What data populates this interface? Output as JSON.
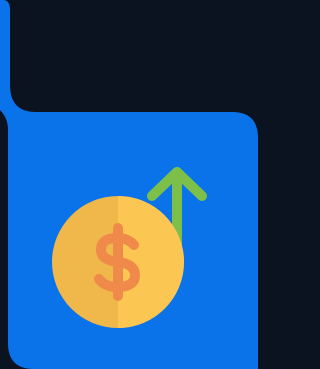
{
  "colors": {
    "background": "#0b1220",
    "card": "#0b73ea",
    "arrow": "#7cc04a",
    "coin_left": "#f0b84a",
    "coin_right": "#fcc653",
    "dollar": "#f08a4b"
  },
  "icons": {
    "panel": "folder-tab-shape",
    "arrow": "arrow-up-icon",
    "coin": "coin-icon",
    "dollar": "dollar-sign-icon"
  }
}
